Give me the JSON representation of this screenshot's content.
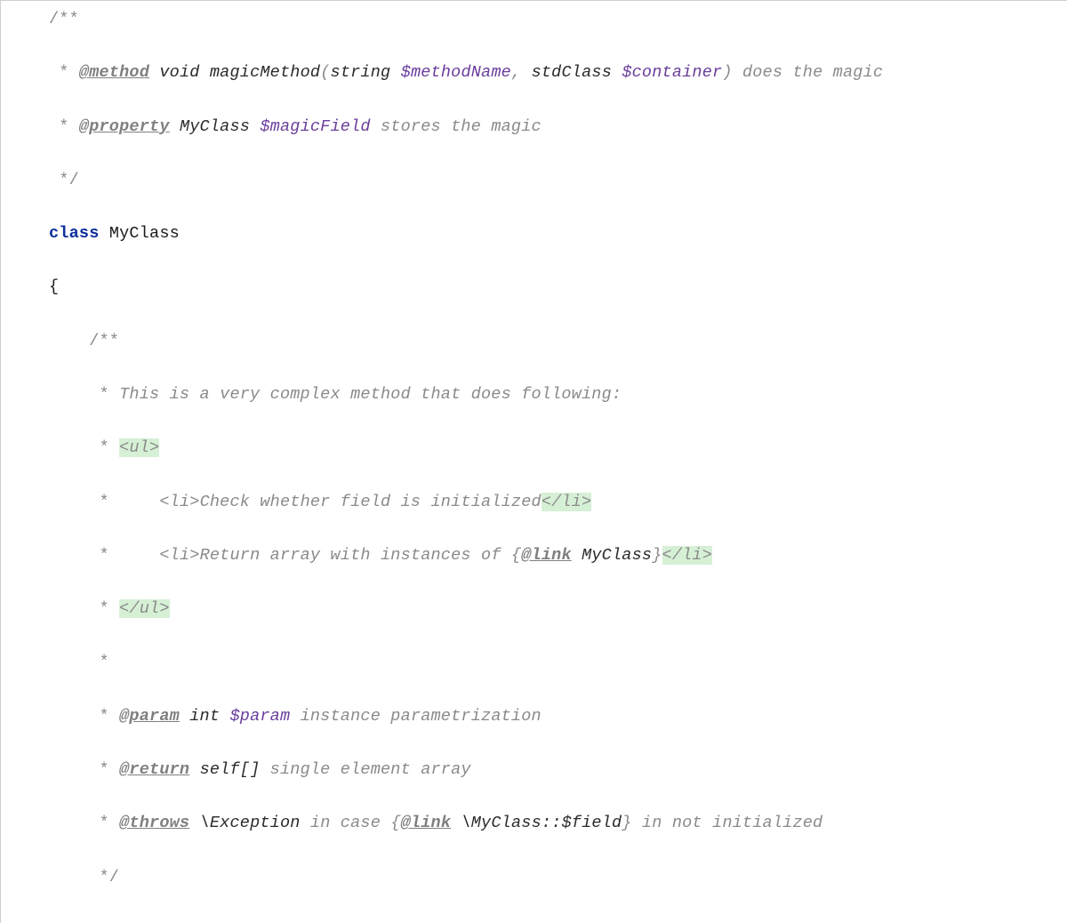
{
  "comment_open": "/**",
  "comment_star": " * ",
  "comment_star_plain": " *",
  "comment_close": " */",
  "class_doc": {
    "method": {
      "tag": "@method",
      "returns": "void",
      "name": "magicMethod",
      "paren_open": "(",
      "p1_type": "string",
      "p1_name": "$methodName",
      "sep": ", ",
      "p2_type": "stdClass",
      "p2_name": "$container",
      "paren_close": ")",
      "desc": " does the magic"
    },
    "property": {
      "tag": "@property",
      "type": "MyClass",
      "name": "$magicField",
      "desc": " stores the magic"
    }
  },
  "class_decl": {
    "keyword": "class",
    "name": "MyClass",
    "brace_open": "{"
  },
  "method_doc": {
    "open": "    /**",
    "star": "     * ",
    "star_plain": "     *",
    "close": "     */",
    "desc": "This is a very complex method that does following:",
    "ul_open": "<ul>",
    "ul_close": "</ul>",
    "li_indent": "    ",
    "li_open": "<li>",
    "li_close": "</li>",
    "li1_text": "Check whether field is initialized",
    "li2_text": "Return array with instances of ",
    "li2_link_open": "{",
    "li2_link_tag": "@link",
    "li2_link_sp": " ",
    "li2_link_target": "MyClass",
    "li2_link_close": "}",
    "param": {
      "tag": "@param",
      "type": "int",
      "name": "$param",
      "desc": " instance parametrization"
    },
    "ret": {
      "tag": "@return",
      "type": "self[]",
      "desc": " single element array"
    },
    "throws": {
      "tag": "@throws",
      "type": "\\Exception",
      "desc1": " in case ",
      "link_open": "{",
      "link_tag": "@link",
      "link_sp": " ",
      "link_target": "\\MyClass::$field",
      "link_close": "}",
      "desc2": " in not initialized"
    }
  }
}
